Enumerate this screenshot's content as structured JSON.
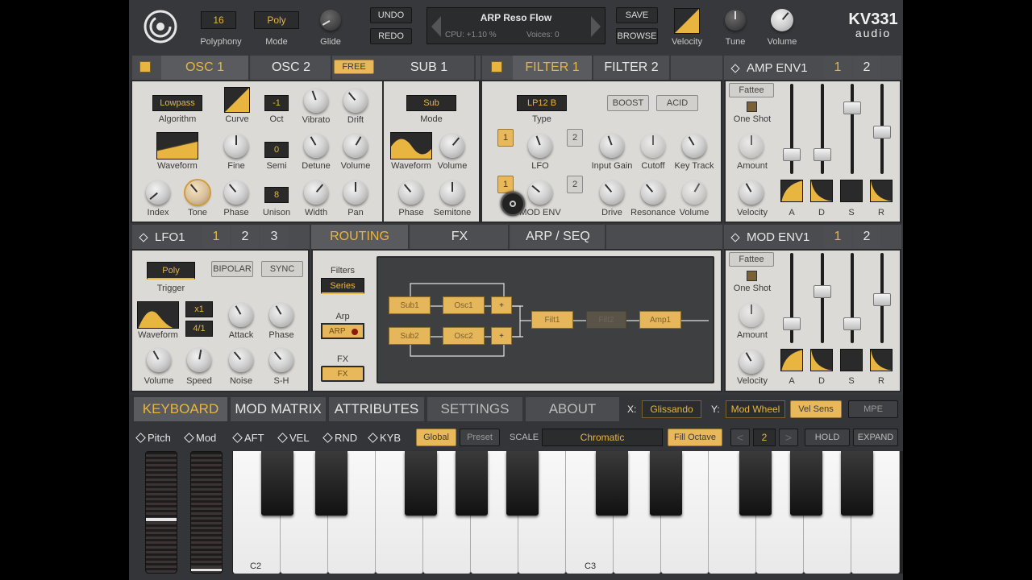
{
  "header": {
    "polyphony_value": "16",
    "polyphony_label": "Polyphony",
    "mode_value": "Poly",
    "mode_label": "Mode",
    "glide_label": "Glide",
    "undo": "UNDO",
    "redo": "REDO",
    "preset_name": "ARP Reso Flow",
    "cpu": "CPU: +1.10 %",
    "voices": "Voices: 0",
    "save": "SAVE",
    "browse": "BROWSE",
    "velocity_label": "Velocity",
    "tune_label": "Tune",
    "volume_label": "Volume",
    "brand_top": "KV331",
    "brand_bottom": "audio"
  },
  "osc": {
    "tab1": "OSC 1",
    "tab2": "OSC 2",
    "free": "FREE",
    "sub_tab": "SUB 1",
    "algorithm_value": "Lowpass",
    "algorithm_label": "Algorithm",
    "curve_label": "Curve",
    "oct_value": "-1",
    "oct_label": "Oct",
    "vibrato_label": "Vibrato",
    "drift_label": "Drift",
    "waveform_label": "Waveform",
    "fine_label": "Fine",
    "semi_value": "0",
    "semi_label": "Semi",
    "detune_label": "Detune",
    "volume_label": "Volume",
    "index_label": "Index",
    "tone_label": "Tone",
    "phase_label": "Phase",
    "unison_value": "8",
    "unison_label": "Unison",
    "width_label": "Width",
    "pan_label": "Pan",
    "sub_mode_value": "Sub",
    "sub_mode_label": "Mode",
    "sub_waveform_label": "Waveform",
    "sub_volume_label": "Volume",
    "sub_phase_label": "Phase",
    "sub_semitone_label": "Semitone"
  },
  "filter": {
    "tab1": "FILTER 1",
    "tab2": "FILTER 2",
    "type_value": "LP12 B",
    "type_label": "Type",
    "boost": "BOOST",
    "acid": "ACID",
    "lfo_label": "LFO",
    "mod_env_label": "MOD ENV",
    "n1": "1",
    "n2": "2",
    "n3": "1",
    "n4": "2",
    "input_gain_label": "Input Gain",
    "cutoff_label": "Cutoff",
    "key_track_label": "Key Track",
    "drive_label": "Drive",
    "resonance_label": "Resonance",
    "volume_label": "Volume"
  },
  "amp_env": {
    "title": "AMP ENV1",
    "n1": "1",
    "n2": "2",
    "fattee": "Fattee",
    "one_shot": "One Shot",
    "amount_label": "Amount",
    "velocity_label": "Velocity",
    "a": "A",
    "d": "D",
    "s": "S",
    "r": "R"
  },
  "mod_env": {
    "title": "MOD ENV1",
    "n1": "1",
    "n2": "2",
    "fattee": "Fattee",
    "one_shot": "One Shot",
    "amount_label": "Amount",
    "velocity_label": "Velocity",
    "a": "A",
    "d": "D",
    "s": "S",
    "r": "R"
  },
  "lfo": {
    "title": "LFO1",
    "n1": "1",
    "n2": "2",
    "n3": "3",
    "poly": "Poly",
    "trigger_label": "Trigger",
    "bipolar": "BIPOLAR",
    "sync": "SYNC",
    "x1": "x1",
    "div": "4/1",
    "waveform_label": "Waveform",
    "attack_label": "Attack",
    "phase_label": "Phase",
    "volume_label": "Volume",
    "speed_label": "Speed",
    "noise_label": "Noise",
    "sh_label": "S-H"
  },
  "routing": {
    "tab_routing": "ROUTING",
    "tab_fx": "FX",
    "tab_arp": "ARP / SEQ",
    "filters_label": "Filters",
    "filters_value": "Series",
    "arp_label": "Arp",
    "arp_value": "ARP",
    "fx_label": "FX",
    "fx_value": "FX",
    "blocks": {
      "sub1": "Sub1",
      "osc1": "Osc1",
      "sub2": "Sub2",
      "osc2": "Osc2",
      "plus": "+",
      "filt1": "Filt1",
      "filt2": "Filt2",
      "amp1": "Amp1"
    }
  },
  "bottom": {
    "tabs": [
      "KEYBOARD",
      "MOD MATRIX",
      "ATTRIBUTES",
      "SETTINGS",
      "ABOUT"
    ],
    "x_label": "X:",
    "x_value": "Glissando",
    "y_label": "Y:",
    "y_value": "Mod Wheel",
    "vel_sens": "Vel Sens",
    "mpe": "MPE",
    "mods": [
      "Pitch",
      "Mod",
      "AFT",
      "VEL",
      "RND",
      "KYB"
    ],
    "global": "Global",
    "preset": "Preset",
    "scale_label": "SCALE",
    "scale_value": "Chromatic",
    "fill_octave": "Fill Octave",
    "octave_value": "2",
    "hold": "HOLD",
    "expand": "EXPAND",
    "c2": "C2",
    "c3": "C3"
  },
  "colors": {
    "accent": "#e8b640",
    "panel": "#dcdad6",
    "chrome": "#36383b"
  }
}
